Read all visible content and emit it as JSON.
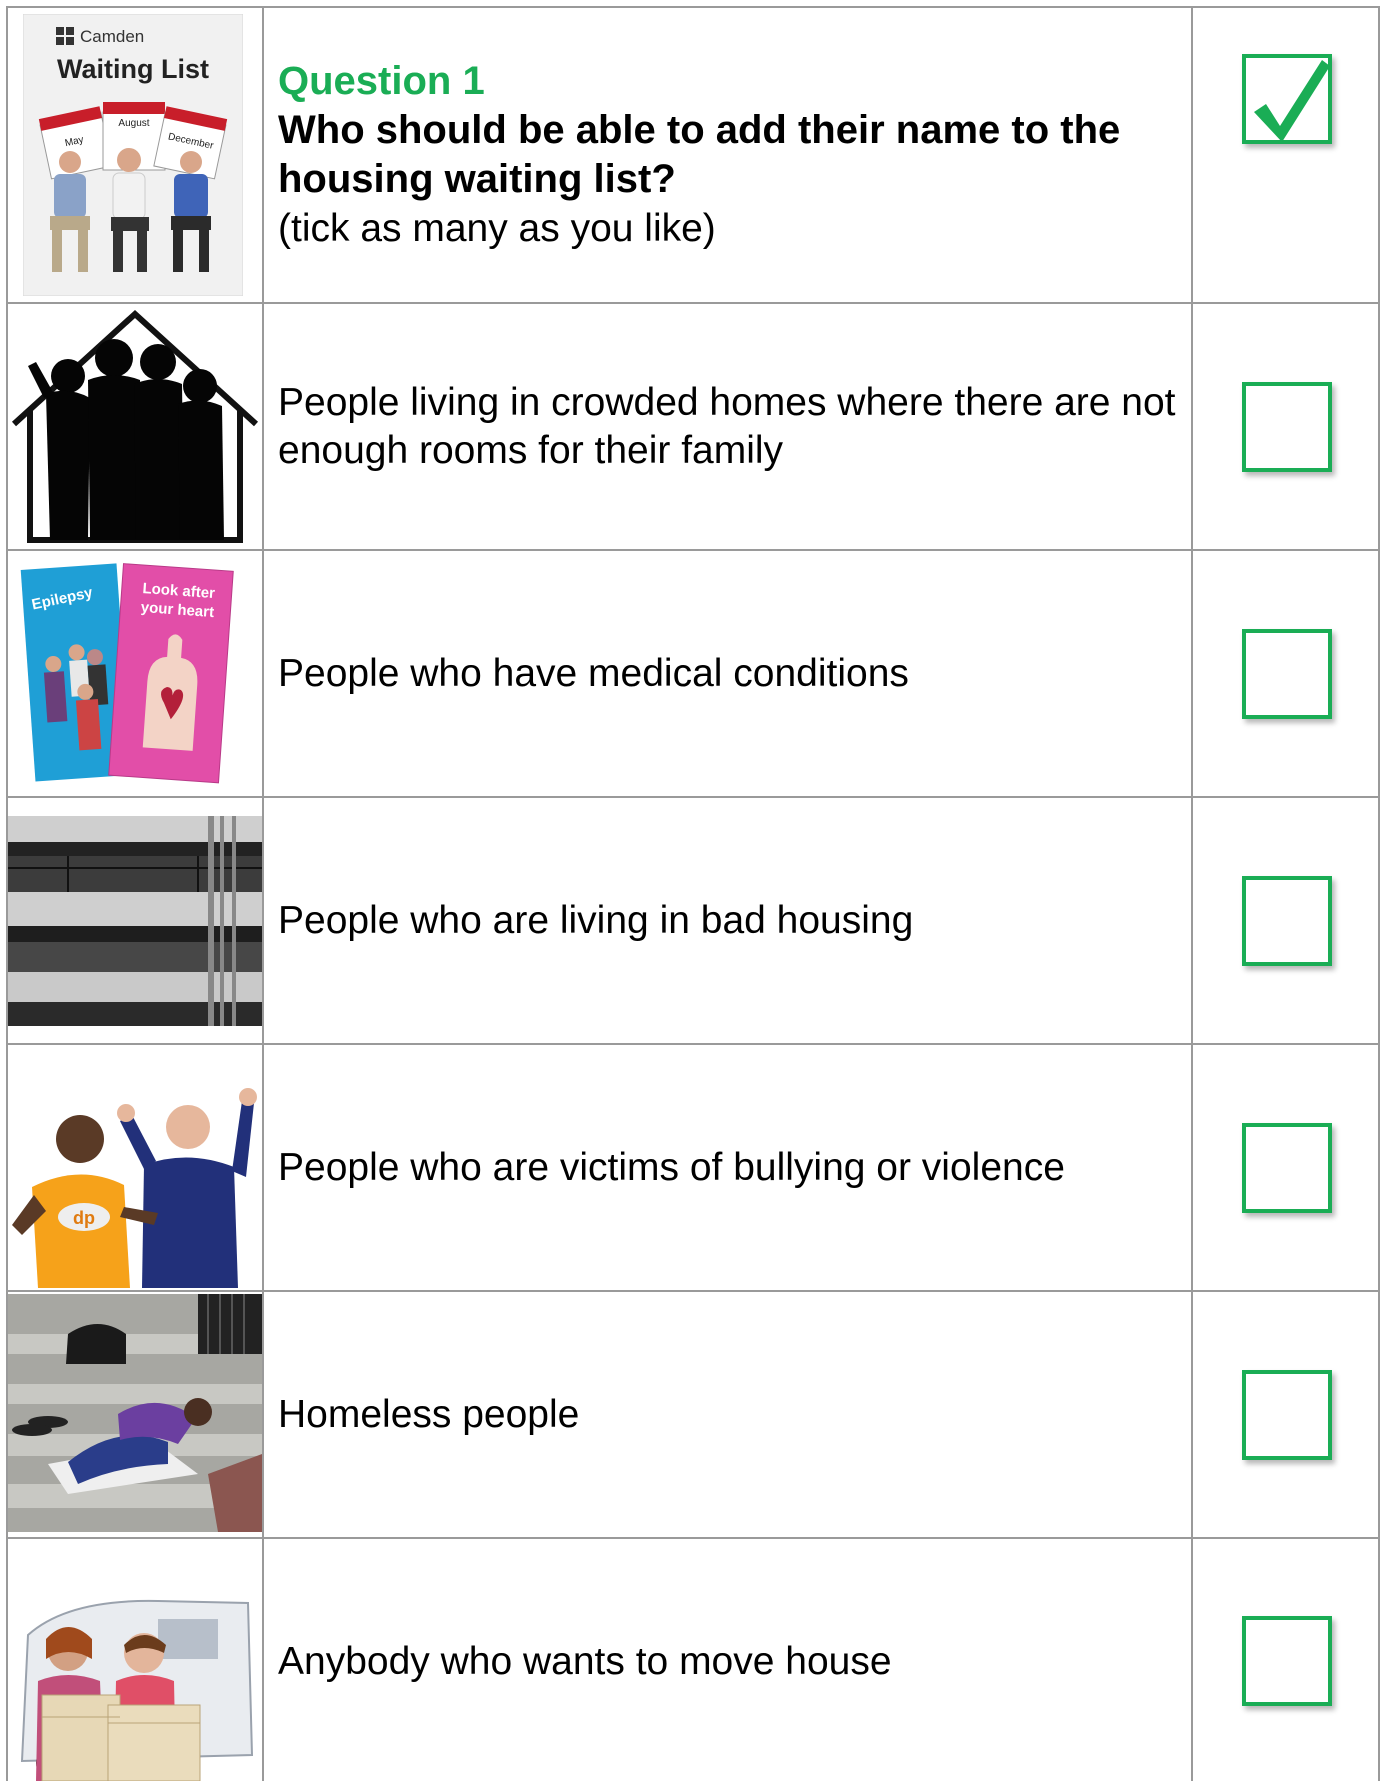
{
  "question": {
    "number": "Question 1",
    "title": "Who should be able to add their name to the housing waiting list?",
    "note": "(tick as many as you like)",
    "header_image": {
      "brand": "Camden",
      "title": "Waiting List",
      "months": [
        "May",
        "August",
        "December"
      ]
    },
    "header_tick": {
      "icon": "checkmark-icon",
      "checked": true
    }
  },
  "options": [
    {
      "text": "People living in crowded homes where there are not enough rooms for their family",
      "image": "crowded-house-silhouette",
      "checked": false
    },
    {
      "text": "People who have medical conditions",
      "image": "medical-leaflets",
      "leaflet_labels": [
        "Epilepsy",
        "Look after your heart"
      ],
      "checked": false
    },
    {
      "text": "People who are living in bad housing",
      "image": "tower-block-balconies",
      "checked": false
    },
    {
      "text": "People who are victims of bullying or violence",
      "image": "two-men-gesturing",
      "shirt_logo": "dp",
      "checked": false
    },
    {
      "text": "Homeless people",
      "image": "person-sleeping-on-steps",
      "checked": false
    },
    {
      "text": "Anybody who wants to move house",
      "image": "people-with-boxes-and-van",
      "checked": false
    }
  ],
  "colors": {
    "accent_green": "#1aad55",
    "grid_line": "#9a9a9a"
  }
}
